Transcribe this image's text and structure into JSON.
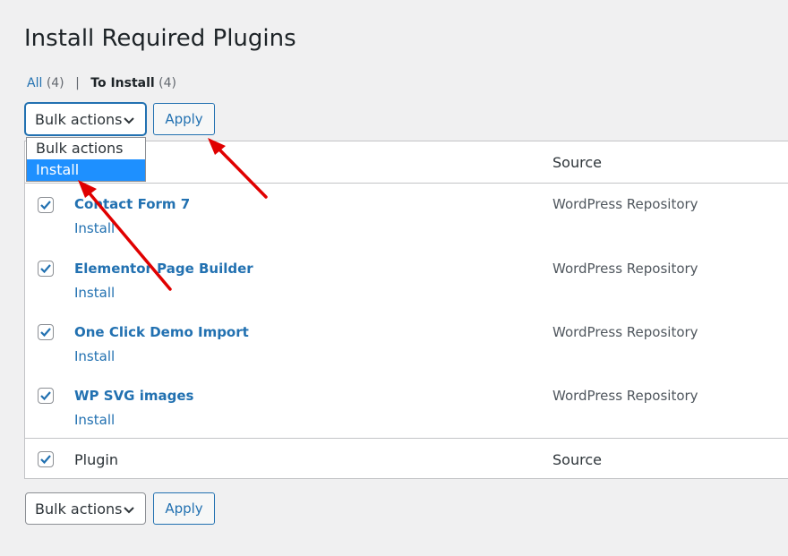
{
  "page": {
    "title": "Install Required Plugins"
  },
  "filters": {
    "all": {
      "label": "All",
      "count": "(4)"
    },
    "separator": "|",
    "to_install": {
      "label": "To Install",
      "count": "(4)"
    }
  },
  "bulk_top": {
    "select_value": "Bulk actions",
    "apply_label": "Apply",
    "options": [
      "Bulk actions",
      "Install"
    ],
    "highlighted_option": "Install"
  },
  "table": {
    "header": {
      "source": "Source"
    },
    "rows": [
      {
        "name": "Contact Form 7",
        "action": "Install",
        "source": "WordPress Repository",
        "checked": true
      },
      {
        "name": "Elementor Page Builder",
        "action": "Install",
        "source": "WordPress Repository",
        "checked": true
      },
      {
        "name": "One Click Demo Import",
        "action": "Install",
        "source": "WordPress Repository",
        "checked": true
      },
      {
        "name": "WP SVG images",
        "action": "Install",
        "source": "WordPress Repository",
        "checked": true
      }
    ],
    "footer": {
      "plugin": "Plugin",
      "source": "Source"
    }
  },
  "bulk_bottom": {
    "select_value": "Bulk actions",
    "apply_label": "Apply"
  },
  "colors": {
    "link": "#2271b1",
    "highlight": "#1e90ff",
    "annotation_arrow": "#e00000",
    "checkbox": "#2271b1"
  },
  "icons": {
    "dropdown": "chevron-down-icon",
    "checkbox": "checkmark-icon",
    "annotation": "arrow-icon"
  }
}
